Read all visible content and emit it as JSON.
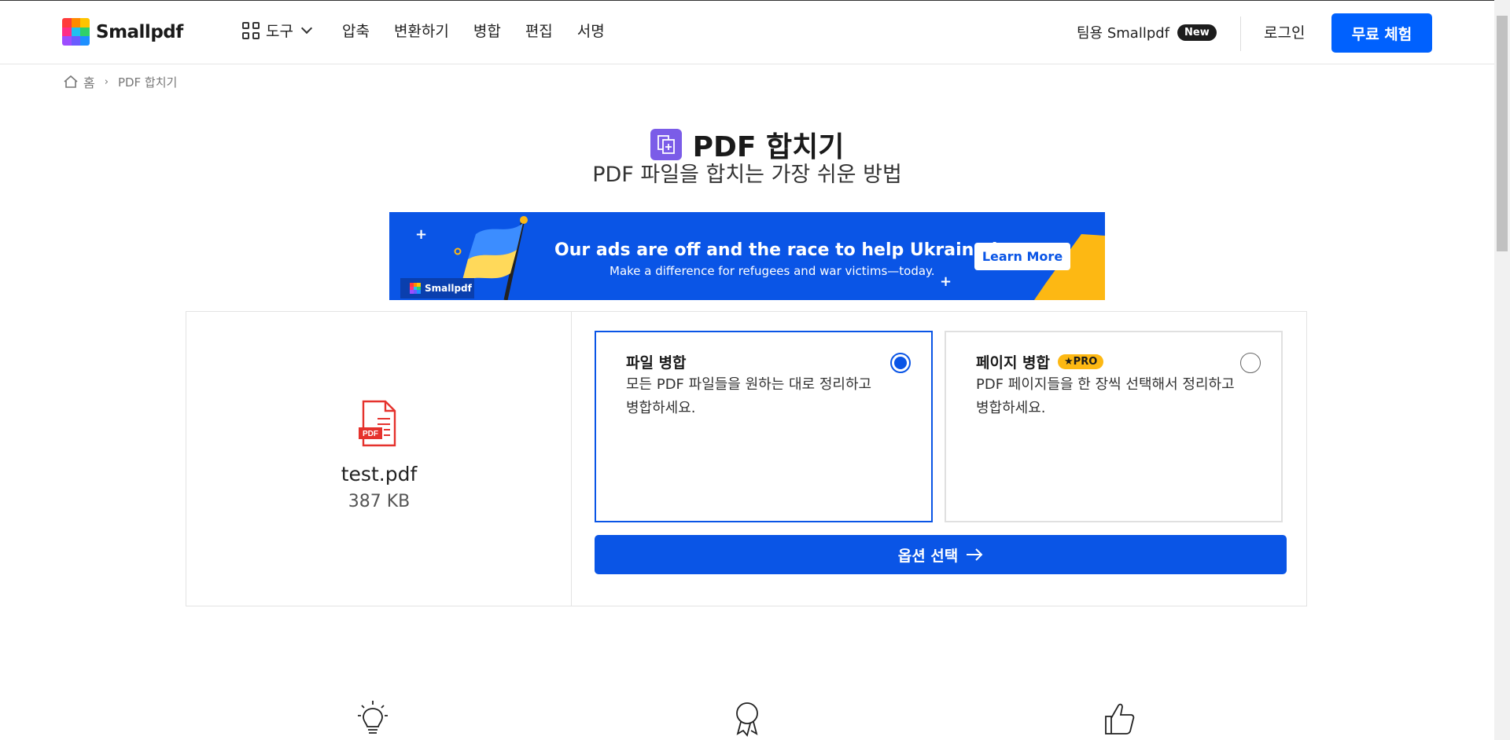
{
  "header": {
    "logo_text": "Smallpdf",
    "tools_label": "도구",
    "nav": [
      "압축",
      "변환하기",
      "병합",
      "편집",
      "서명"
    ],
    "team_label": "팀용 Smallpdf",
    "new_badge": "New",
    "login_label": "로그인",
    "trial_label": "무료 체험"
  },
  "breadcrumb": {
    "home": "홈",
    "current": "PDF 합치기"
  },
  "page": {
    "title": "PDF 합치기",
    "subtitle": "PDF 파일을 합치는 가장 쉬운 방법"
  },
  "banner": {
    "title": "Our ads are off and the race to help Ukraine is on",
    "subtitle": "Make a difference for refugees and war victims—today.",
    "button": "Learn More",
    "logo": "Smallpdf"
  },
  "file": {
    "badge": "PDF",
    "name": "test.pdf",
    "size": "387 KB"
  },
  "options": [
    {
      "title": "파일 병합",
      "desc": "모든 PDF 파일들을 원하는 대로 정리하고 병합하세요.",
      "selected": true
    },
    {
      "title": "페이지 병합",
      "pro": "★PRO",
      "desc": "PDF 페이지들을 한 장씩 선택해서 정리하고 병합하세요.",
      "selected": false
    }
  ],
  "choose_button": "옵션 선택",
  "colors": {
    "primary": "#0061fe",
    "banner_blue": "#0a55e6",
    "pro_yellow": "#fdb813",
    "title_icon": "#7b5ce8",
    "pdf_red": "#e5322d"
  },
  "icons": [
    "grid-icon",
    "chevron-down-icon",
    "home-icon",
    "merge-icon",
    "pdf-file-icon",
    "arrow-right-icon",
    "lightbulb-icon",
    "award-icon",
    "thumbs-up-icon"
  ]
}
